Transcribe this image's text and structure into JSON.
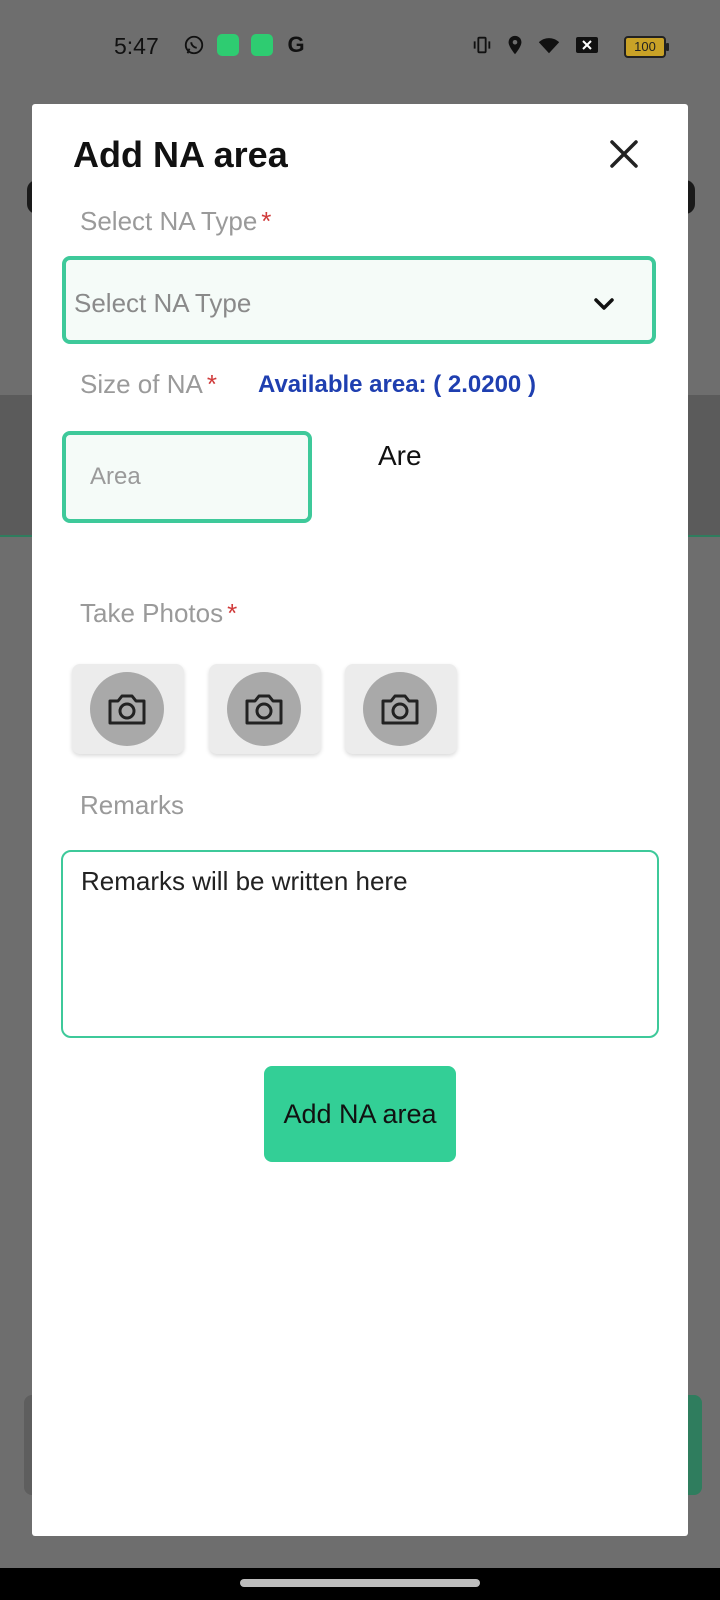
{
  "status_bar": {
    "time": "5:47",
    "battery": "100",
    "left_icons": [
      "whatsapp-icon",
      "app-icon",
      "app-icon",
      "google-icon"
    ],
    "right_icons": [
      "vibrate-icon",
      "location-icon",
      "wifi-icon",
      "no-sim-icon",
      "battery-icon"
    ]
  },
  "dialog": {
    "title": "Add NA area",
    "na_type": {
      "label": "Select NA Type",
      "required_mark": "*",
      "placeholder": "Select NA Type"
    },
    "size": {
      "label": "Size of NA",
      "required_mark": "*",
      "available_area": "Available area: ( 2.0200 )",
      "placeholder": "Area",
      "unit": "Are"
    },
    "photos": {
      "label": "Take Photos",
      "required_mark": "*",
      "slots": 3
    },
    "remarks": {
      "label": "Remarks",
      "placeholder": "Remarks will be written here"
    },
    "submit_label": "Add NA area"
  },
  "colors": {
    "accent": "#3ec99a",
    "button": "#33cf96",
    "link_blue": "#1f3fb0",
    "required_red": "#d03a3a"
  }
}
